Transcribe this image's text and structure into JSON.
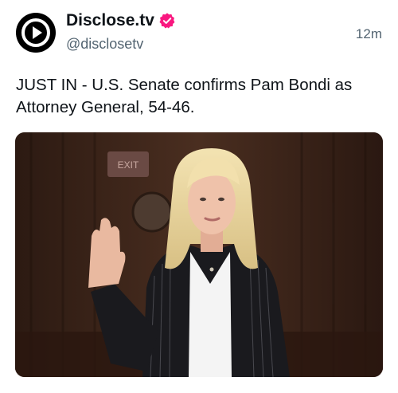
{
  "account": {
    "display_name": "Disclose.tv",
    "handle": "@disclosetv",
    "avatar_icon": "play-icon",
    "verified_icon": "verified-badge-icon",
    "verified_color": "#f91880"
  },
  "post": {
    "time": "12m",
    "text": "JUST IN - U.S. Senate confirms Pam Bondi as Attorney General, 54-46.",
    "image_sign_text": "EXIT"
  },
  "colors": {
    "primary_text": "#0f1419",
    "secondary_text": "#536471"
  }
}
